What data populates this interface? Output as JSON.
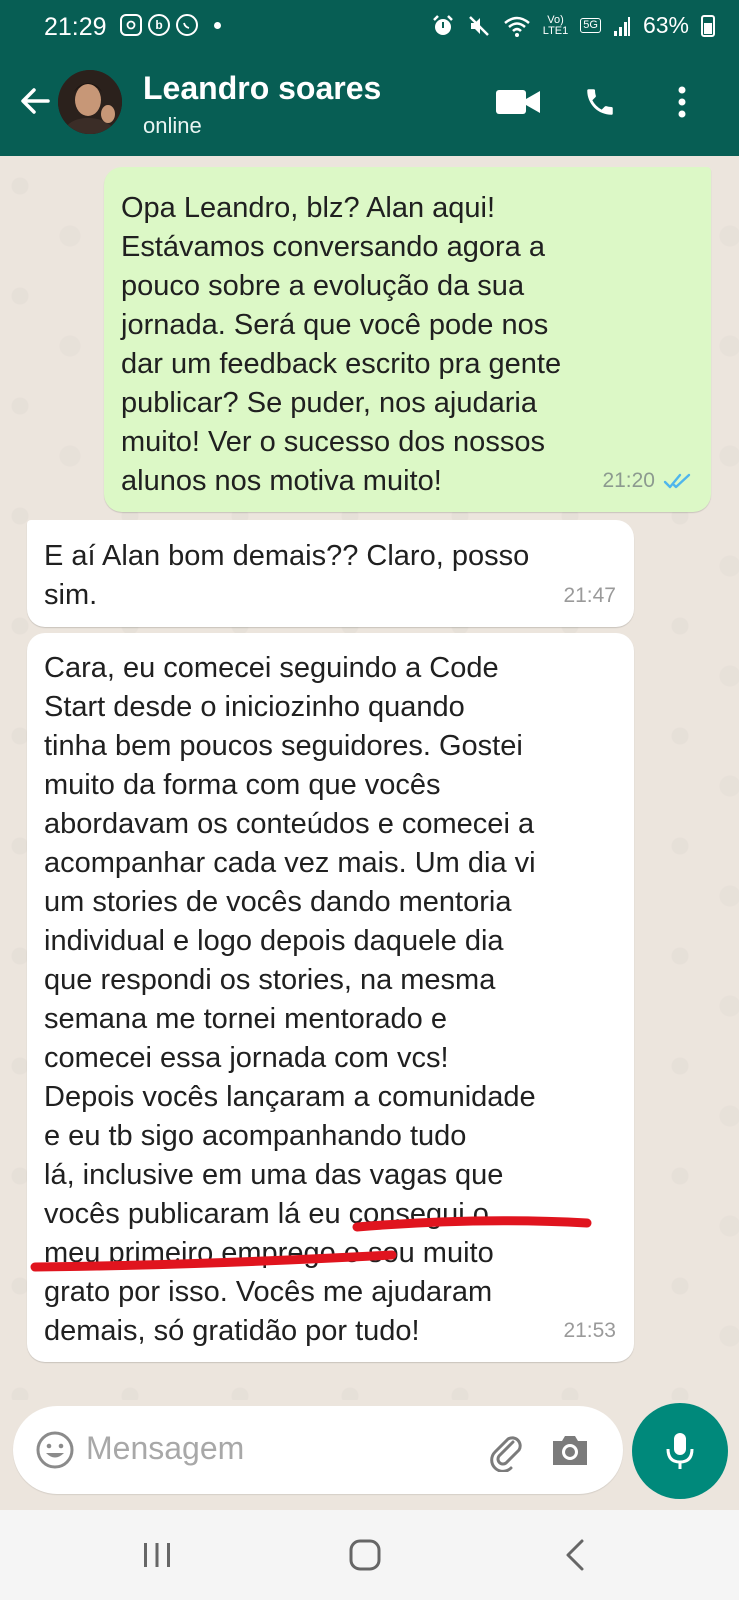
{
  "status_bar": {
    "time": "21:29",
    "left_icons": [
      "instagram-icon",
      "b-icon",
      "whatsapp-icon",
      "notification-dot"
    ],
    "right_icons": [
      "alarm-icon",
      "mute-icon",
      "wifi-icon",
      "volte-icon",
      "5g-icon",
      "signal-icon"
    ],
    "volte_label_top": "Vo)",
    "volte_label_bottom": "LTE1",
    "network_label": "5G",
    "battery": "63%"
  },
  "header": {
    "contact_name": "Leandro soares",
    "contact_status": "online",
    "background": "#075e54"
  },
  "messages": [
    {
      "direction": "outgoing",
      "text": "Opa Leandro, blz? Alan aqui!\nEstávamos conversando agora a\npouco sobre a evolução da sua\njornada. Será que você pode nos\ndar um feedback escrito pra gente\npublicar? Se puder, nos ajudaria\nmuito! Ver o sucesso dos nossos\nalunos nos motiva muito!",
      "time": "21:20",
      "read": true
    },
    {
      "direction": "incoming",
      "text": "E aí Alan bom demais?? Claro, posso\nsim.",
      "time": "21:47"
    },
    {
      "direction": "incoming",
      "text": "Cara, eu comecei seguindo a Code\nStart desde o iniciozinho quando\ntinha bem poucos seguidores. Gostei\nmuito da forma com que vocês\nabordavam os conteúdos e comecei a\nacompanhar cada vez mais. Um dia vi\num stories de vocês dando mentoria\nindividual e logo depois daquele dia\nque respondi os stories, na mesma\nsemana me tornei mentorado e\ncomecei essa jornada com vcs!\nDepois vocês lançaram a comunidade\ne eu tb sigo acompanhando tudo\nlá, inclusive em uma das vagas que\nvocês publicaram lá eu consegui o\nmeu primeiro emprego e sou muito\ngrato por isso. Vocês me ajudaram\ndemais, só gratidão por tudo!",
      "time": "21:53"
    }
  ],
  "composer": {
    "placeholder": "Mensagem"
  },
  "colors": {
    "outgoing_bubble": "#dcf8c6",
    "incoming_bubble": "#ffffff",
    "chat_background": "#ece5dd",
    "accent": "#00897b",
    "highlight_underline": "#e0141e"
  }
}
